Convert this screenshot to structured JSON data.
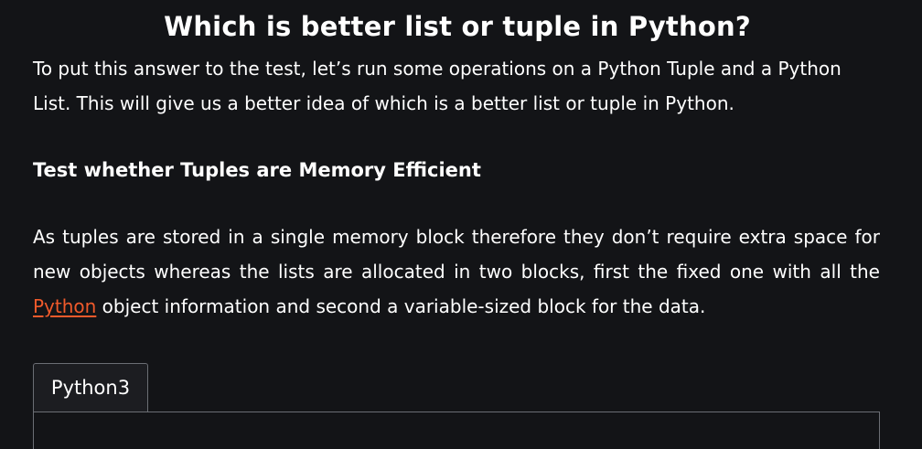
{
  "article": {
    "title": "Which is better list or tuple in Python?",
    "intro": "To put this answer to the test, let’s run some operations on a Python Tuple and a Python List. This will give us a better idea of which is a better list or tuple in Python.",
    "section_heading": "Test whether Tuples are Memory Efficient",
    "body_before_link": "As tuples are stored in a single memory block therefore they don’t require extra space for new objects whereas the lists are allocated in two blocks, first the fixed one with all the ",
    "link_text": "Python",
    "body_after_link": " object information and second a variable-sized block for the data."
  },
  "code_block": {
    "tab_label": "Python3"
  },
  "colors": {
    "background": "#131417",
    "text": "#ffffff",
    "link": "#f05a2b",
    "tab_background": "#1c1d21",
    "border": "#6b6e74"
  }
}
